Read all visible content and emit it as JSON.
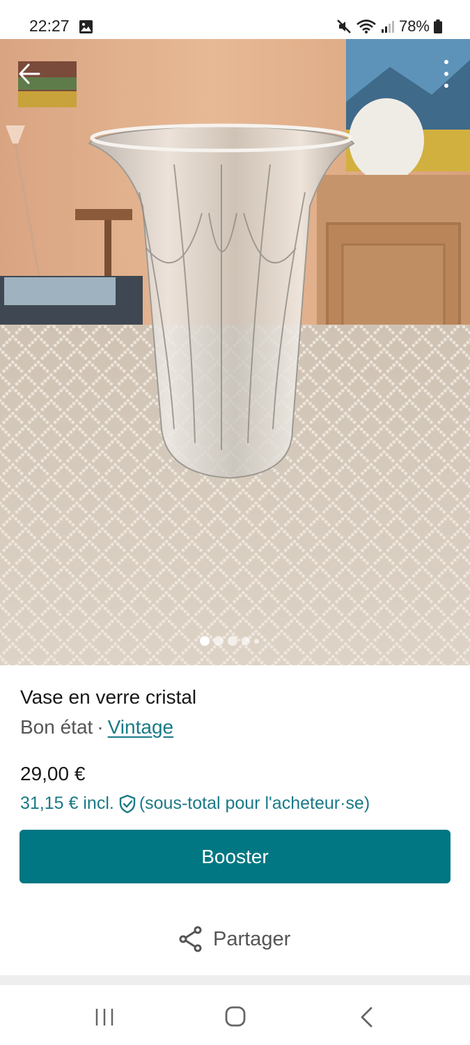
{
  "status_bar": {
    "time": "22:27",
    "battery": "78%",
    "icons": [
      "image-icon",
      "mute-icon",
      "wifi-icon",
      "signal-icon",
      "battery-icon"
    ]
  },
  "photo": {
    "total_images": 5,
    "active_index": 0,
    "icons": {
      "back": "arrow-left-icon",
      "menu": "more-vertical-icon"
    }
  },
  "item": {
    "title": "Vase en verre cristal",
    "condition": "Bon état",
    "separator": "·",
    "category_link": "Vintage",
    "price": "29,00 €",
    "price_incl": "31,15 € incl.",
    "price_incl_note": "(sous-total pour l'acheteur·se)"
  },
  "actions": {
    "boost_label": "Booster",
    "share_label": "Partager"
  },
  "colors": {
    "accent": "#007782",
    "link": "#1a7a87",
    "text": "#171717",
    "muted": "#555555"
  },
  "nav_bar": {
    "icons": [
      "recent-apps-icon",
      "home-icon",
      "back-icon"
    ]
  }
}
